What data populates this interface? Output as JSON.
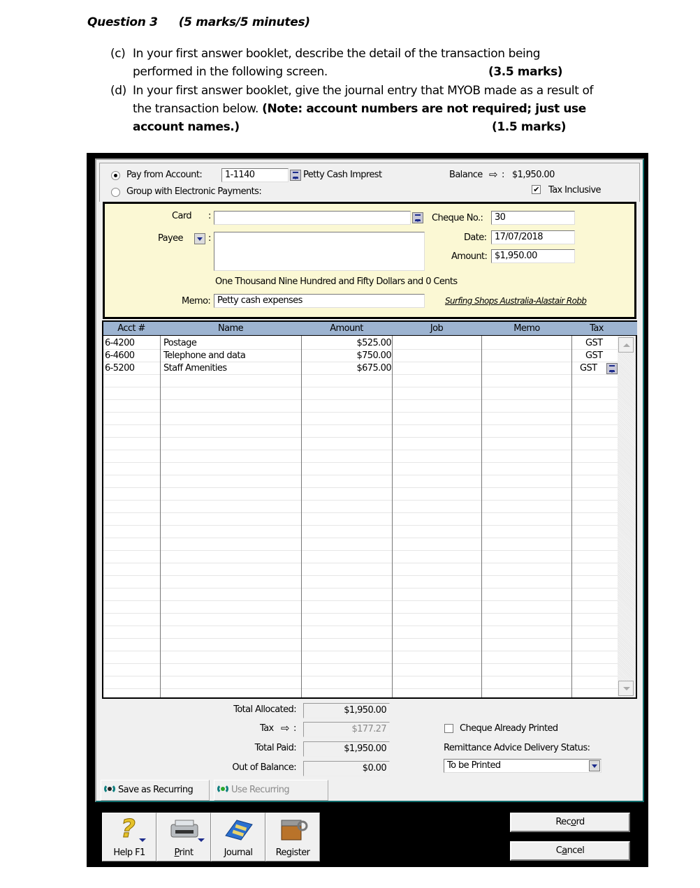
{
  "question": {
    "title": "Question 3",
    "marks": "(5 marks/5 minutes)",
    "parts": [
      {
        "label": "(c)",
        "line1": "In your first answer booklet, describe the detail of the transaction being",
        "line2": "performed in the following screen.",
        "marks": "(3.5 marks)"
      },
      {
        "label": "(d)",
        "line1": "In your first answer booklet, give the journal entry that MYOB made as a result of",
        "line2_plain": "the transaction below. ",
        "line2_bold": "(Note: account numbers are not required; just use",
        "line3_bold": "account names.)",
        "marks": "(1.5 marks)"
      }
    ]
  },
  "spend_money": {
    "pay_from_label": "Pay from Account:",
    "pay_from_selected": true,
    "account_number": "1-1140",
    "account_name": "Petty Cash Impres­t",
    "group_electronic_label": "Group with Electronic Payments:",
    "balance_label": "Balance",
    "balance_value": "$1,950.00",
    "tax_inclusive_label": "Tax Inclusive",
    "tax_inclusive_checked": true,
    "cheque": {
      "card_label": "Card",
      "card_value": "",
      "payee_label": "Payee",
      "payee_value": "",
      "cheque_no_label": "Cheque No.:",
      "cheque_no_value": "30",
      "date_label": "Date:",
      "date_value": "17/07/2018",
      "amount_label": "Amount:",
      "amount_value": "$1,950.00",
      "amount_words": "One Thousand Nine Hundred and Fifty Dollars and 0 Cents",
      "memo_label": "Memo:",
      "memo_value": "Petty cash expenses",
      "company_signature": "Surfing Shops Australia-Alastair Robb"
    },
    "grid": {
      "columns": [
        "Acct #",
        "Name",
        "Amount",
        "Job",
        "Memo",
        "Tax"
      ],
      "rows": [
        {
          "acct": "6-4200",
          "name": "Postage",
          "amount": "$525.00",
          "job": "",
          "memo": "",
          "tax": "GST"
        },
        {
          "acct": "6-4600",
          "name": "Telephone and data",
          "amount": "$750.00",
          "job": "",
          "memo": "",
          "tax": "GST"
        },
        {
          "acct": "6-5200",
          "name": "Staff Amenities",
          "amount": "$675.00",
          "job": "",
          "memo": "",
          "tax": "GST"
        }
      ]
    },
    "totals": {
      "total_allocated_label": "Total Allocated:",
      "total_allocated_value": "$1,950.00",
      "tax_label": "Tax",
      "tax_value": "$177.27",
      "total_paid_label": "Total Paid:",
      "total_paid_value": "$1,950.00",
      "out_of_balance_label": "Out of Balance:",
      "out_of_balance_value": "$0.00"
    },
    "cheque_already_printed_label": "Cheque Already Printed",
    "cheque_already_printed_checked": false,
    "remittance_label": "Remittance Advice Delivery Status:",
    "remittance_value": "To be Printed",
    "save_recurring_label": "Save as Recurring",
    "use_recurring_label": "Use Recurring",
    "toolbar": {
      "help": "Help F1",
      "print": "Print",
      "journal": "Journal",
      "register": "Register"
    },
    "record_label": "Record",
    "cancel_label": "Cancel"
  }
}
